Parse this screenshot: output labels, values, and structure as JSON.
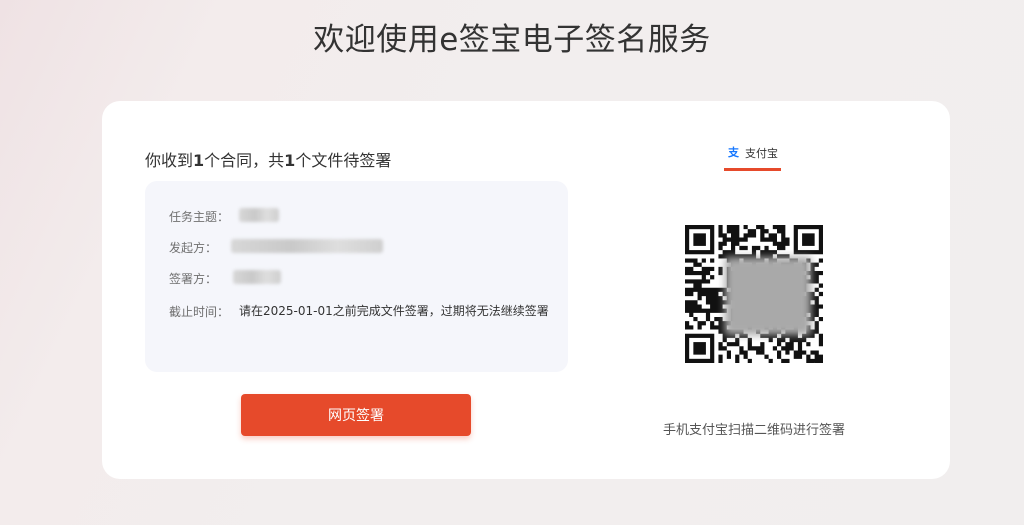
{
  "page": {
    "title": "欢迎使用e签宝电子签名服务"
  },
  "contract": {
    "summary_prefix": "你收到",
    "contract_count": "1",
    "summary_mid": "个合同，共",
    "file_count": "1",
    "summary_suffix": "个文件待签署",
    "fields": [
      {
        "label": "任务主题：",
        "value": ""
      },
      {
        "label": "发起方：",
        "value": ""
      },
      {
        "label": "签署方：",
        "value": ""
      },
      {
        "label": "截止时间：",
        "value": "请在2025-01-01之前完成文件签署，过期将无法继续签署"
      }
    ]
  },
  "actions": {
    "web_sign_label": "网页签署"
  },
  "qr_panel": {
    "tab_label": "支付宝",
    "tab_icon": "alipay-icon",
    "caption": "手机支付宝扫描二维码进行签署"
  },
  "colors": {
    "accent": "#e64a2b",
    "alipay_blue": "#1677ff",
    "info_bg": "#f5f6fb"
  }
}
